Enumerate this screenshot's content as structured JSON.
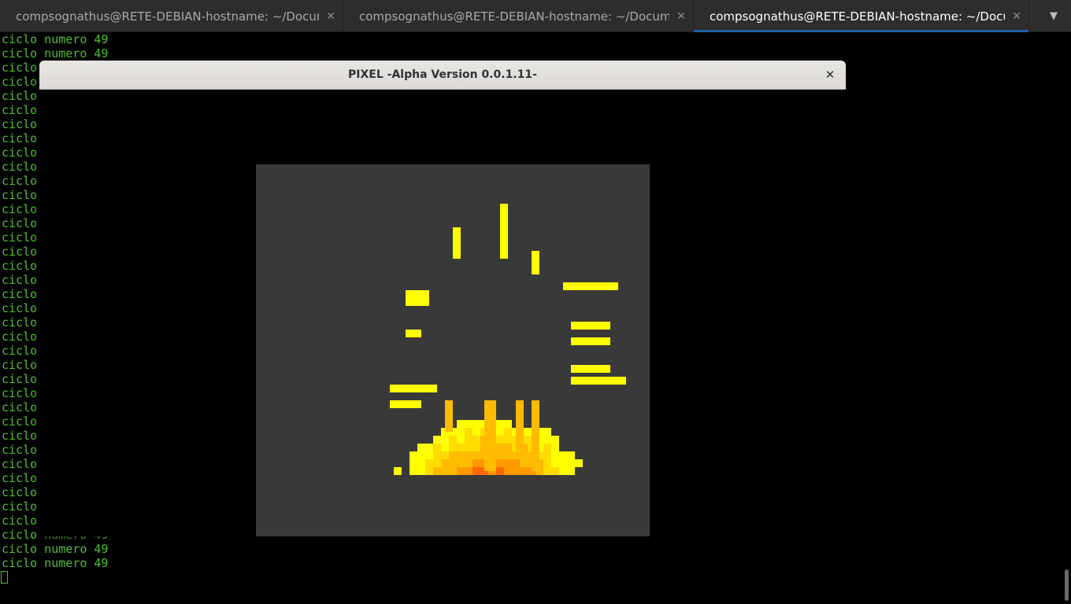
{
  "tabs": [
    {
      "label": "compsognathus@RETE-DEBIAN-hostname: ~/Docume...",
      "close": "✕",
      "active": false
    },
    {
      "label": "compsognathus@RETE-DEBIAN-hostname: ~/Docume...",
      "close": "✕",
      "active": false
    },
    {
      "label": "compsognathus@RETE-DEBIAN-hostname: ~/Docume...",
      "close": "✕",
      "active": true
    }
  ],
  "tab_menu_icon": "chevron-down-icon",
  "terminal": {
    "text_color": "#4ec12f",
    "lines": [
      "ciclo numero 49",
      "ciclo numero 49",
      "ciclo",
      "ciclo",
      "ciclo",
      "ciclo",
      "ciclo",
      "ciclo",
      "ciclo",
      "ciclo",
      "ciclo",
      "ciclo",
      "ciclo",
      "ciclo",
      "ciclo",
      "ciclo",
      "ciclo",
      "ciclo",
      "ciclo",
      "ciclo",
      "ciclo",
      "ciclo",
      "ciclo",
      "ciclo",
      "ciclo",
      "ciclo",
      "ciclo",
      "ciclo",
      "ciclo",
      "ciclo",
      "ciclo",
      "ciclo",
      "ciclo",
      "ciclo",
      "ciclo numero 49",
      "ciclo numero 49",
      "ciclo numero 49",
      "ciclo numero 49"
    ]
  },
  "window": {
    "title": "PIXEL -Alpha Version 0.0.1.11-",
    "close": "✕",
    "canvas_bg": "#393939",
    "pixel_colors": [
      "#ffff00",
      "#ffdd00",
      "#ffbb00",
      "#ff9900",
      "#ff6600",
      "#ff3300",
      "#ff0000"
    ]
  }
}
